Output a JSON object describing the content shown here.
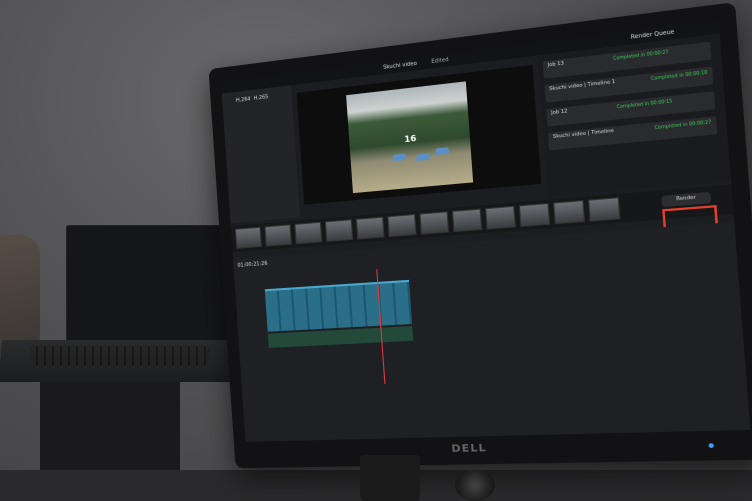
{
  "screen": {
    "project_title": "Skuchi video",
    "status": "Edited",
    "viewer_frame_number": "16",
    "render_queue_title": "Render Queue",
    "render_button": "Render",
    "jobs": [
      {
        "id": "Job 13",
        "title": "Skuchi video | Timeline 1",
        "status": "Completed in 00:00:27"
      },
      {
        "id": "Job 11",
        "title": "Skuchi video | Timeline 1",
        "status": "Completed in 00:00:10"
      },
      {
        "id": "Job 12",
        "title": "Skuchi video | Timeline 1",
        "status": "Completed in 00:00:15"
      },
      {
        "id": "Job 13",
        "title": "Skuchi video | Timeline",
        "status": "Completed in 00:00:27"
      }
    ],
    "formats": [
      "H.264",
      "H.265"
    ],
    "timecode": "01:00:21:26"
  },
  "monitor_brand": "DELL"
}
